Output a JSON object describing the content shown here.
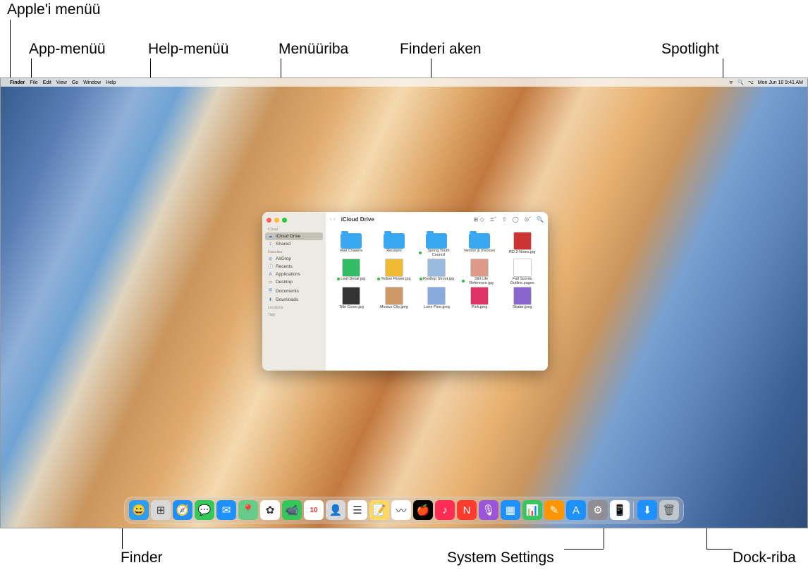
{
  "callouts": {
    "apple_menu": "Apple'i menüü",
    "app_menu": "App-menüü",
    "help_menu": "Help-menüü",
    "menubar": "Menüüriba",
    "finder_window": "Finderi aken",
    "spotlight": "Spotlight",
    "finder_dock": "Finder",
    "system_settings": "System Settings",
    "dock": "Dock-riba"
  },
  "menubar": {
    "app": "Finder",
    "items": [
      "File",
      "Edit",
      "View",
      "Go",
      "Window",
      "Help"
    ],
    "right_datetime": "Mon Jun 10  9:41 AM"
  },
  "finder": {
    "title": "iCloud Drive",
    "sidebar": {
      "sections": [
        {
          "label": "iCloud",
          "items": [
            {
              "label": "iCloud Drive",
              "icon": "☁",
              "active": true
            },
            {
              "label": "Shared",
              "icon": "⇪",
              "active": false
            }
          ]
        },
        {
          "label": "Favorites",
          "items": [
            {
              "label": "AirDrop",
              "icon": "◎",
              "active": false
            },
            {
              "label": "Recents",
              "icon": "🕘",
              "active": false
            },
            {
              "label": "Applications",
              "icon": "A",
              "active": false
            },
            {
              "label": "Desktop",
              "icon": "▭",
              "active": false
            },
            {
              "label": "Documents",
              "icon": "🗎",
              "active": false
            },
            {
              "label": "Downloads",
              "icon": "⬇",
              "active": false
            }
          ]
        },
        {
          "label": "Locations",
          "items": []
        },
        {
          "label": "Tags",
          "items": []
        }
      ]
    },
    "files": [
      {
        "name": "Rail Chasers",
        "type": "folder"
      },
      {
        "name": "Receipts",
        "type": "folder"
      },
      {
        "name": "Spring Youth Council",
        "type": "folder",
        "dot": true
      },
      {
        "name": "Vendor & Invoices",
        "type": "folder"
      },
      {
        "name": "RD.2-Notes.jpg",
        "type": "image",
        "bg": "#c33"
      },
      {
        "name": "Leaf Detail.jpg",
        "type": "image",
        "bg": "#3b6",
        "dot": true
      },
      {
        "name": "Yellow Flower.jpg",
        "type": "image",
        "bg": "#eb3",
        "dot": true
      },
      {
        "name": "Rooftop Shoot.jpg",
        "type": "image",
        "bg": "#9bd",
        "dot": true
      },
      {
        "name": "Still Life Reference.jpg",
        "type": "image",
        "bg": "#d98",
        "dot": true
      },
      {
        "name": "Fall Scents Outline.pages",
        "type": "doc",
        "bg": "#fff"
      },
      {
        "name": "Title Cover.jpg",
        "type": "image",
        "bg": "#333"
      },
      {
        "name": "Mexico City.jpeg",
        "type": "image",
        "bg": "#c96"
      },
      {
        "name": "Lone Pine.jpeg",
        "type": "image",
        "bg": "#8ad"
      },
      {
        "name": "Pink.jpeg",
        "type": "image",
        "bg": "#d36"
      },
      {
        "name": "Skater.jpeg",
        "type": "image",
        "bg": "#86c"
      }
    ]
  },
  "dock": {
    "apps": [
      {
        "name": "Finder",
        "color": "#2a9df4",
        "glyph": "😀"
      },
      {
        "name": "Launchpad",
        "color": "#d8d8d8",
        "glyph": "⊞"
      },
      {
        "name": "Safari",
        "color": "#1e90ff",
        "glyph": "🧭"
      },
      {
        "name": "Messages",
        "color": "#34c759",
        "glyph": "💬"
      },
      {
        "name": "Mail",
        "color": "#1e90ff",
        "glyph": "✉"
      },
      {
        "name": "Maps",
        "color": "#66cc88",
        "glyph": "📍"
      },
      {
        "name": "Photos",
        "color": "#fff",
        "glyph": "✿"
      },
      {
        "name": "FaceTime",
        "color": "#34c759",
        "glyph": "📹"
      },
      {
        "name": "Calendar",
        "color": "#fff",
        "glyph": "10"
      },
      {
        "name": "Contacts",
        "color": "#d8d8d8",
        "glyph": "👤"
      },
      {
        "name": "Reminders",
        "color": "#fff",
        "glyph": "☰"
      },
      {
        "name": "Notes",
        "color": "#ffd860",
        "glyph": "📝"
      },
      {
        "name": "Freeform",
        "color": "#fff",
        "glyph": "〰"
      },
      {
        "name": "TV",
        "color": "#000",
        "glyph": "🍎"
      },
      {
        "name": "Music",
        "color": "#ff2d55",
        "glyph": "♪"
      },
      {
        "name": "News",
        "color": "#ff3b30",
        "glyph": "N"
      },
      {
        "name": "Podcasts",
        "color": "#9a55d9",
        "glyph": "🎙"
      },
      {
        "name": "Keynote",
        "color": "#1e90ff",
        "glyph": "▦"
      },
      {
        "name": "Numbers",
        "color": "#34c759",
        "glyph": "📊"
      },
      {
        "name": "Pages",
        "color": "#ff9500",
        "glyph": "✎"
      },
      {
        "name": "App Store",
        "color": "#1e90ff",
        "glyph": "A"
      },
      {
        "name": "System Settings",
        "color": "#8e8e93",
        "glyph": "⚙"
      },
      {
        "name": "iPhone Mirroring",
        "color": "#fff",
        "glyph": "📱"
      }
    ],
    "extras": [
      {
        "name": "Downloads",
        "color": "#1e90ff",
        "glyph": "⬇"
      },
      {
        "name": "Trash",
        "color": "#c0c7cc",
        "glyph": "🗑"
      }
    ]
  }
}
